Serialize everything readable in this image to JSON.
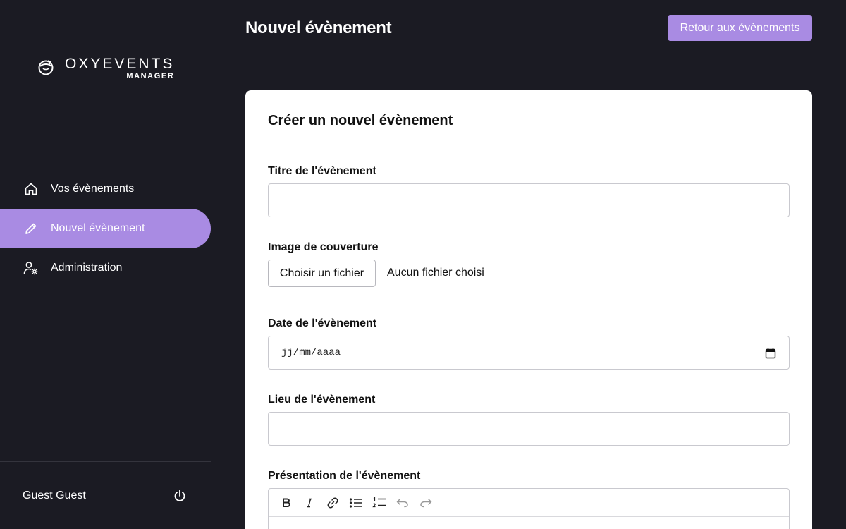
{
  "brand": {
    "name": "OXYEVENTS",
    "subtitle": "MANAGER"
  },
  "nav": {
    "items": [
      {
        "label": "Vos évènements",
        "icon": "home-icon",
        "active": false
      },
      {
        "label": "Nouvel évènement",
        "icon": "pencil-icon",
        "active": true
      },
      {
        "label": "Administration",
        "icon": "user-gear-icon",
        "active": false
      }
    ]
  },
  "user": {
    "name": "Guest Guest",
    "logout_icon": "power-icon"
  },
  "header": {
    "title": "Nouvel évènement",
    "back_label": "Retour aux évènements"
  },
  "form": {
    "section_title": "Créer un nouvel évènement",
    "title_label": "Titre de l'évènement",
    "title_value": "",
    "cover_label": "Image de couverture",
    "file_button": "Choisir un fichier",
    "file_status": "Aucun fichier choisi",
    "date_label": "Date de l'évènement",
    "date_placeholder": "jj/mm/aaaa",
    "location_label": "Lieu de l'évènement",
    "location_value": "",
    "description_label": "Présentation de l'évènement",
    "toolbar": [
      "bold-icon",
      "italic-icon",
      "link-icon",
      "bullet-list-icon",
      "numbered-list-icon",
      "undo-icon",
      "redo-icon"
    ]
  },
  "colors": {
    "accent": "#a98be3",
    "background": "#1b1b23",
    "card": "#ffffff"
  }
}
